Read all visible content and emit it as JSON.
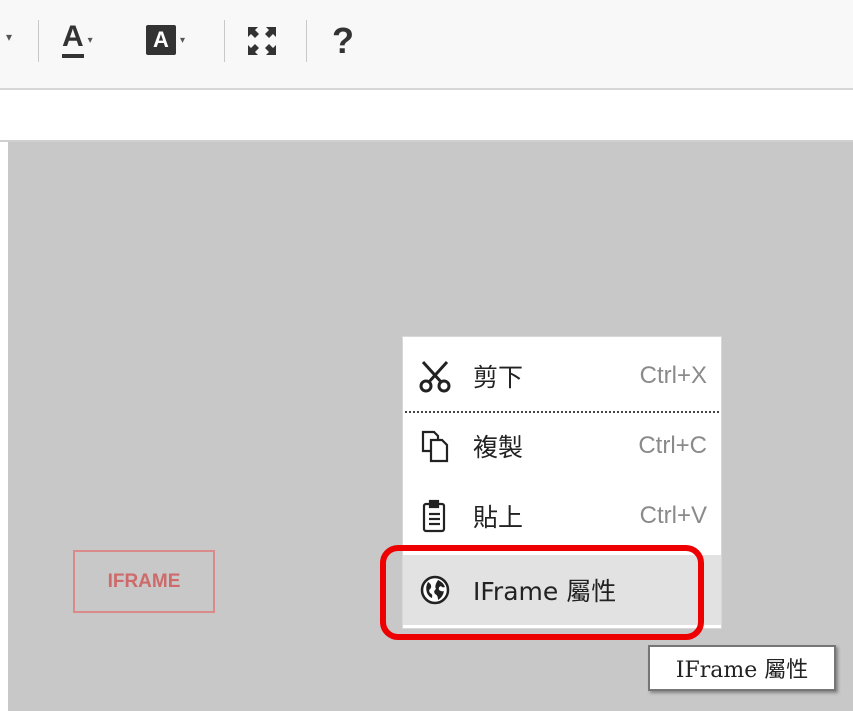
{
  "toolbar": {
    "left_arrow": "▾",
    "text_color_glyph": "A",
    "text_color_arrow": "▾",
    "bg_color_glyph": "A",
    "bg_color_arrow": "▾",
    "help_glyph": "?",
    "icons": [
      "dropdown-arrow-icon",
      "text-color-icon",
      "background-color-icon",
      "maximize-icon",
      "help-icon"
    ]
  },
  "editor": {
    "iframe_placeholder": "IFRAME",
    "background_color": "#c8c8c8"
  },
  "context_menu": {
    "items": [
      {
        "label": "剪下",
        "shortcut": "Ctrl+X",
        "icon": "scissors-icon"
      },
      {
        "label": "複製",
        "shortcut": "Ctrl+C",
        "icon": "copy-icon"
      },
      {
        "label": "貼上",
        "shortcut": "Ctrl+V",
        "icon": "paste-icon"
      },
      {
        "label": "IFrame 屬性",
        "shortcut": "",
        "icon": "globe-icon"
      }
    ]
  },
  "tooltip": {
    "text": "IFrame 屬性"
  },
  "colors": {
    "highlight": "#ee0000",
    "placeholder_text": "#cf6a6a"
  }
}
